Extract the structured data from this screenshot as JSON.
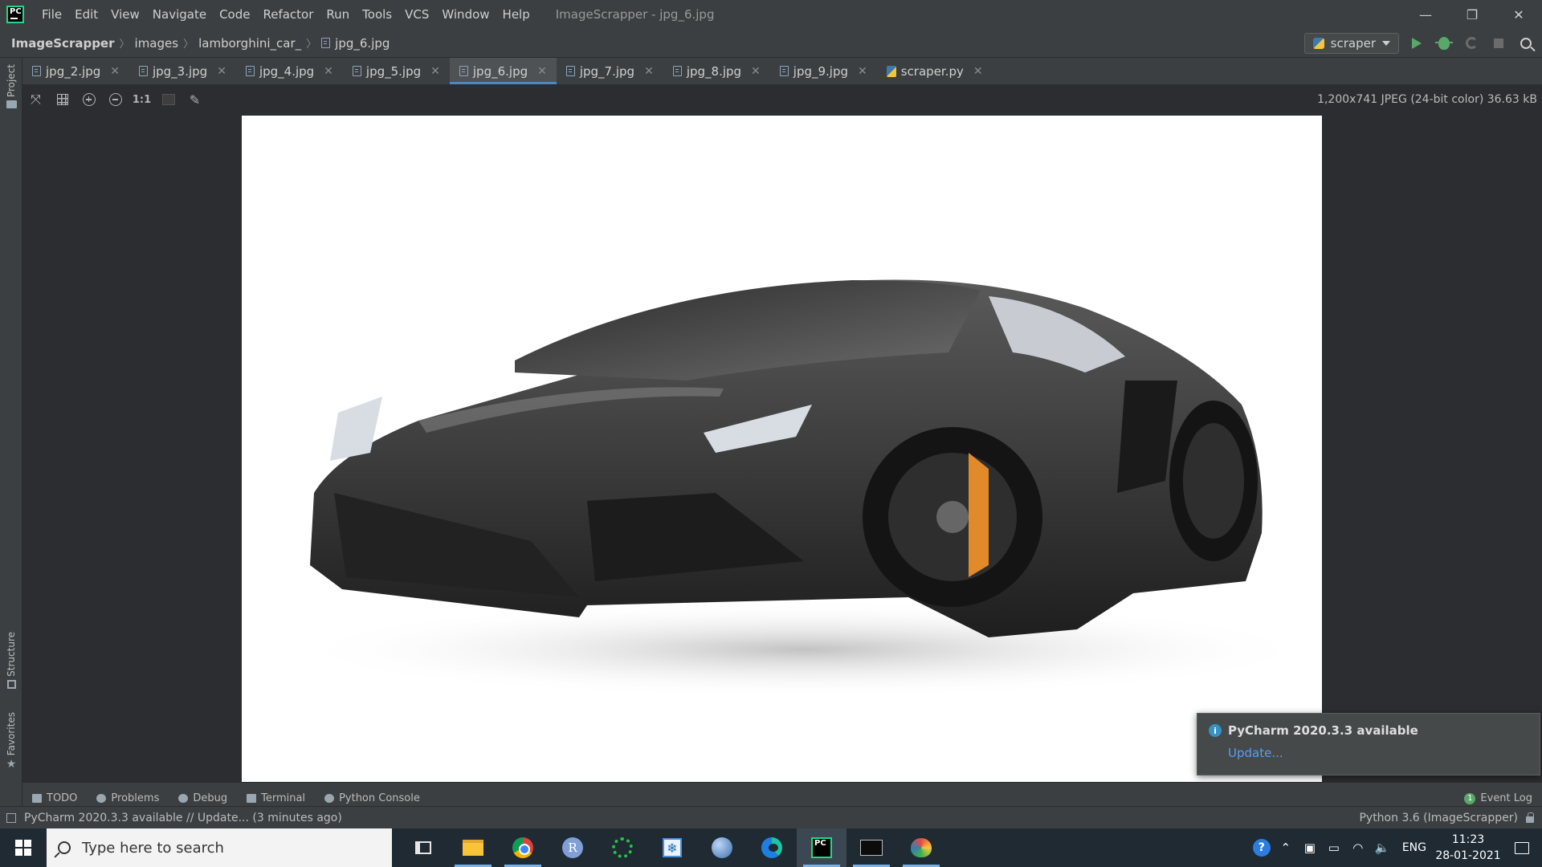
{
  "titlebar": {
    "menu": [
      "File",
      "Edit",
      "View",
      "Navigate",
      "Code",
      "Refactor",
      "Run",
      "Tools",
      "VCS",
      "Window",
      "Help"
    ],
    "window_title": "ImageScrapper - jpg_6.jpg",
    "controls": {
      "minimize": "—",
      "restore": "❐",
      "close": "✕"
    }
  },
  "breadcrumb": {
    "items": [
      "ImageScrapper",
      "images",
      "lamborghini_car_",
      "jpg_6.jpg"
    ],
    "separator": "〉"
  },
  "toolbar": {
    "run_config": "scraper"
  },
  "left_strip": {
    "project": "Project",
    "structure": "Structure",
    "favorites": "Favorites"
  },
  "tabs": [
    {
      "label": "jpg_2.jpg",
      "type": "image",
      "active": false
    },
    {
      "label": "jpg_3.jpg",
      "type": "image",
      "active": false
    },
    {
      "label": "jpg_4.jpg",
      "type": "image",
      "active": false
    },
    {
      "label": "jpg_5.jpg",
      "type": "image",
      "active": false
    },
    {
      "label": "jpg_6.jpg",
      "type": "image",
      "active": true
    },
    {
      "label": "jpg_7.jpg",
      "type": "image",
      "active": false
    },
    {
      "label": "jpg_8.jpg",
      "type": "image",
      "active": false
    },
    {
      "label": "jpg_9.jpg",
      "type": "image",
      "active": false
    },
    {
      "label": "scraper.py",
      "type": "python",
      "active": false
    }
  ],
  "image_toolbar": {
    "actual_size": "1:1",
    "image_info": "1,200x741 JPEG (24-bit color) 36.63 kB"
  },
  "notification": {
    "title": "PyCharm 2020.3.3 available",
    "link": "Update..."
  },
  "bottom_tools": {
    "items": [
      "TODO",
      "Problems",
      "Debug",
      "Terminal",
      "Python Console"
    ],
    "event_log": "Event Log",
    "event_count": "1"
  },
  "statusbar": {
    "message": "PyCharm 2020.3.3 available // Update... (3 minutes ago)",
    "interpreter": "Python 3.6 (ImageScrapper)"
  },
  "taskbar": {
    "search_placeholder": "Type here to search",
    "apps": [
      "task-view",
      "file-explorer",
      "chrome",
      "r-app",
      "ring-app",
      "snipping-app",
      "globe-app",
      "edge",
      "pycharm",
      "terminal",
      "paint"
    ],
    "lang": "ENG",
    "time": "11:23",
    "date": "28-01-2021"
  },
  "colors": {
    "accent": "#4a88c7",
    "link": "#589df6",
    "run_green": "#59a869",
    "ide_bg": "#2b2d30",
    "panel_bg": "#3c3f41"
  }
}
